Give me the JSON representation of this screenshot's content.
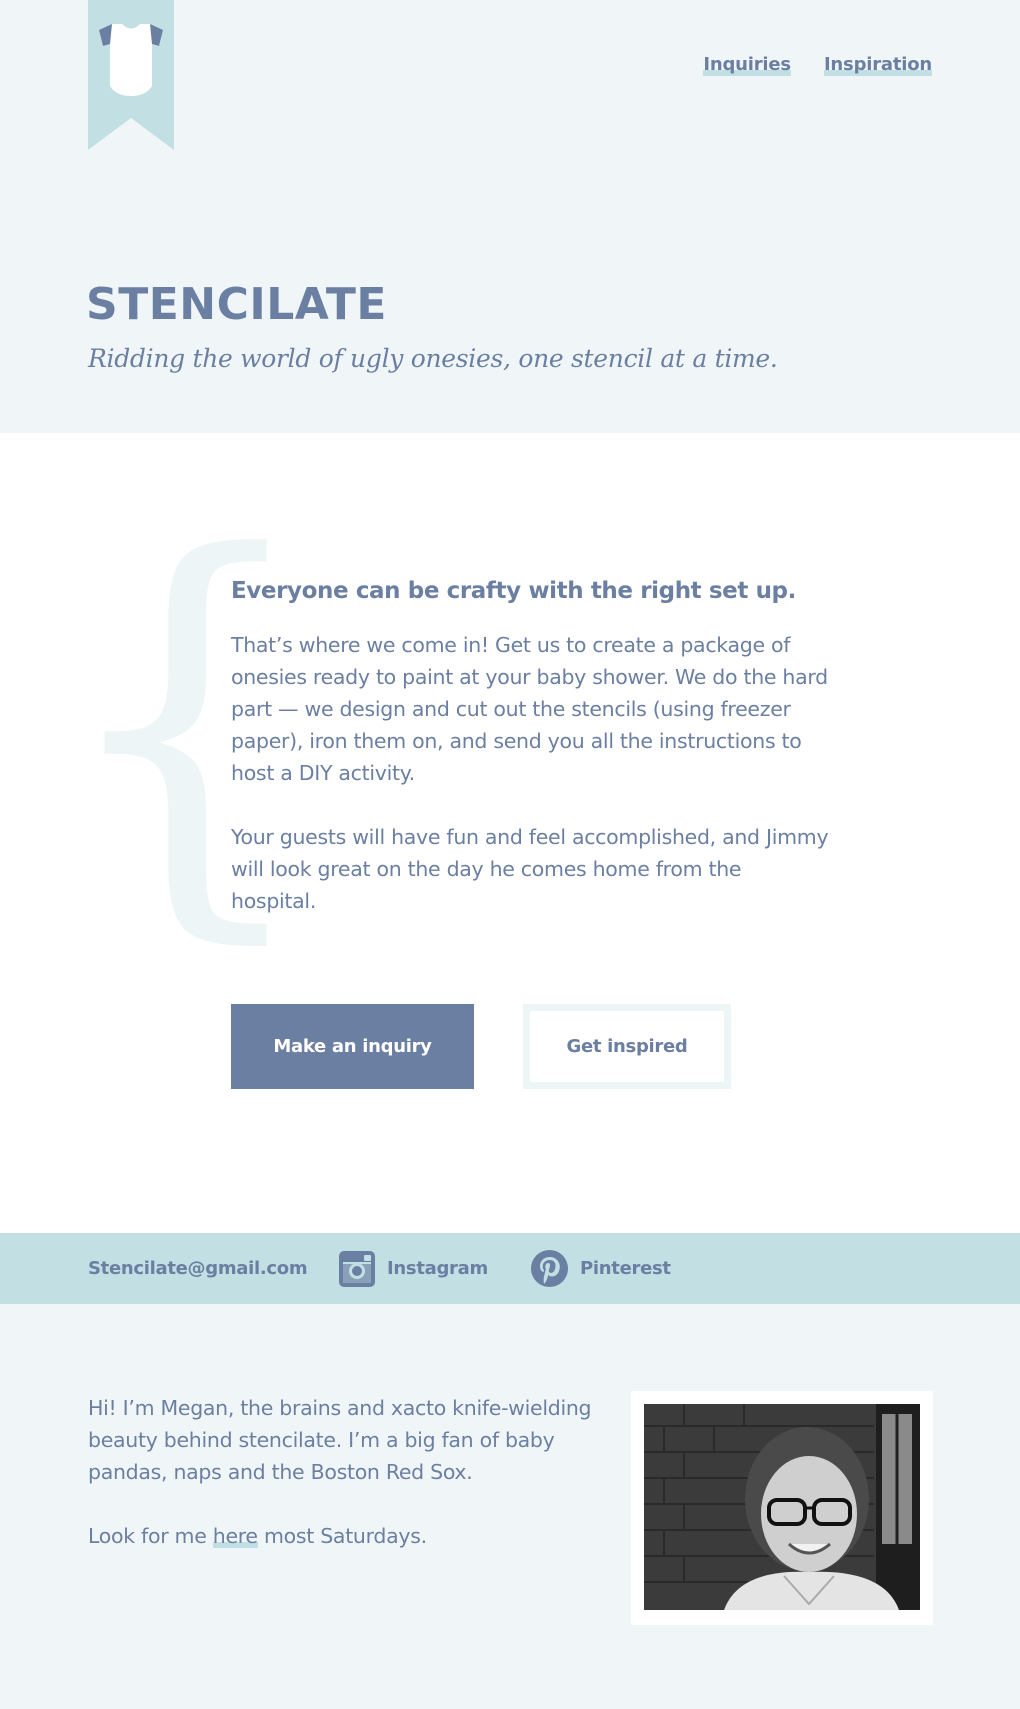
{
  "header": {
    "logo_icon": "onesie-ribbon-icon",
    "nav": {
      "inquiries_label": "Inquiries",
      "inspiration_label": "Inspiration"
    },
    "title": "STENCILATE",
    "tagline": "Ridding the world of ugly onesies, one stencil at a time."
  },
  "main": {
    "headline": "Everyone can be crafty with the right set up.",
    "paragraph_1": "That’s where we come in! Get us to create a package of onesies ready to paint at your baby shower. We do the hard part — we design and cut out the stencils (using freezer paper), iron them on, and send you all the instructions to host a DIY activity.",
    "paragraph_2": "Your guests will have fun and feel accomplished, and Jimmy will look great on the day he comes home from the hospital.",
    "primary_button_label": "Make an inquiry",
    "secondary_button_label": "Get inspired"
  },
  "contact": {
    "email": "Stencilate@gmail.com",
    "instagram_label": "Instagram",
    "instagram_icon": "instagram-icon",
    "pinterest_label": "Pinterest",
    "pinterest_icon": "pinterest-icon"
  },
  "about": {
    "intro": "Hi! I’m Megan, the brains and xacto knife-wielding beauty behind stencilate. I’m a big fan of baby pandas, naps and the Boston Red Sox.",
    "saturday_prefix": "Look for me ",
    "saturday_link": "here",
    "saturday_suffix": " most Saturdays."
  },
  "colors": {
    "background": "#f0f6f8",
    "accent": "#6b7fa2",
    "highlight": "#c2dfe3",
    "white": "#ffffff"
  }
}
